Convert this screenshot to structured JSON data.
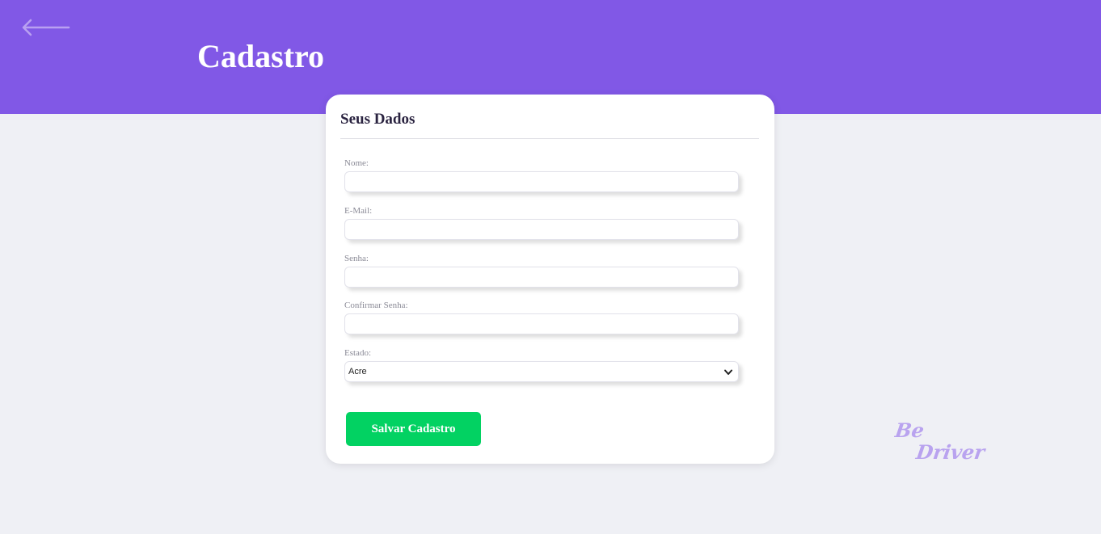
{
  "header": {
    "title": "Cadastro",
    "back_icon": "arrow-left-icon",
    "background": "#8158e6"
  },
  "card": {
    "title": "Seus Dados",
    "fields": [
      {
        "label": "Nome:",
        "value": ""
      },
      {
        "label": "E-Mail:",
        "value": ""
      },
      {
        "label": "Senha:",
        "value": ""
      },
      {
        "label": "Confirmar Senha:",
        "value": ""
      }
    ],
    "state": {
      "label": "Estado:",
      "selected": "Acre",
      "icon": "chevron-down-icon"
    },
    "save_label": "Salvar Cadastro",
    "save_color": "#02d262"
  },
  "logo": {
    "line1": "Be",
    "line2": "Driver",
    "color": "#b9a3ef"
  }
}
